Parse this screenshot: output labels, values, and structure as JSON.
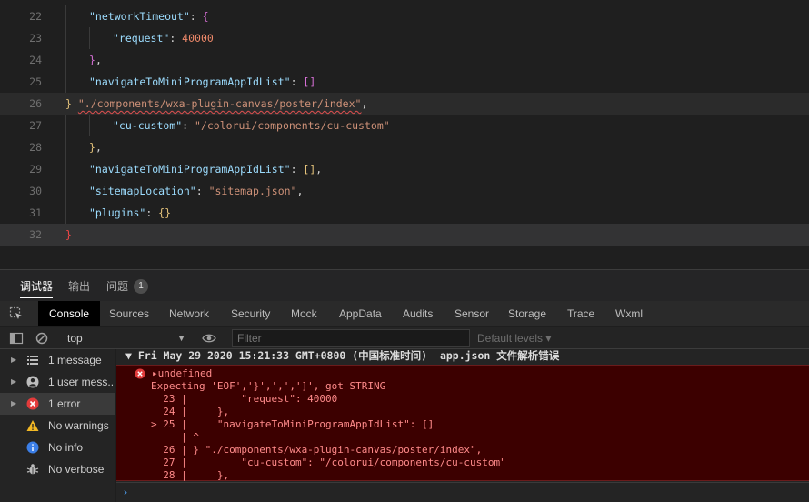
{
  "editor": {
    "lines": [
      {
        "num": "22",
        "indent": 1,
        "parts": [
          {
            "t": "\"networkTimeout\"",
            "c": "k"
          },
          {
            "t": ": ",
            "c": "p"
          },
          {
            "t": "{",
            "c": "b2"
          }
        ]
      },
      {
        "num": "23",
        "indent": 2,
        "parts": [
          {
            "t": "\"request\"",
            "c": "k"
          },
          {
            "t": ": ",
            "c": "p"
          },
          {
            "t": "40000",
            "c": "n"
          }
        ]
      },
      {
        "num": "24",
        "indent": 1,
        "parts": [
          {
            "t": "}",
            "c": "b2"
          },
          {
            "t": ",",
            "c": "p"
          }
        ]
      },
      {
        "num": "25",
        "indent": 1,
        "parts": [
          {
            "t": "\"navigateToMiniProgramAppIdList\"",
            "c": "k"
          },
          {
            "t": ": ",
            "c": "p"
          },
          {
            "t": "[]",
            "c": "b2"
          }
        ]
      },
      {
        "num": "26",
        "indent": 0,
        "parts": [
          {
            "t": "}",
            "c": "b1"
          },
          {
            "t": " ",
            "c": "p"
          },
          {
            "t": "\"./components/wxa-plugin-canvas/poster/index\"",
            "c": "s squig"
          },
          {
            "t": ",",
            "c": "p"
          }
        ]
      },
      {
        "num": "27",
        "indent": 2,
        "parts": [
          {
            "t": "\"cu-custom\"",
            "c": "k"
          },
          {
            "t": ": ",
            "c": "p"
          },
          {
            "t": "\"/colorui/components/cu-custom\"",
            "c": "s"
          }
        ]
      },
      {
        "num": "28",
        "indent": 1,
        "parts": [
          {
            "t": "}",
            "c": "b1"
          },
          {
            "t": ",",
            "c": "p"
          }
        ]
      },
      {
        "num": "29",
        "indent": 1,
        "parts": [
          {
            "t": "\"navigateToMiniProgramAppIdList\"",
            "c": "k"
          },
          {
            "t": ": ",
            "c": "p"
          },
          {
            "t": "[]",
            "c": "b1"
          },
          {
            "t": ",",
            "c": "p"
          }
        ]
      },
      {
        "num": "30",
        "indent": 1,
        "parts": [
          {
            "t": "\"sitemapLocation\"",
            "c": "k"
          },
          {
            "t": ": ",
            "c": "p"
          },
          {
            "t": "\"sitemap.json\"",
            "c": "s"
          },
          {
            "t": ",",
            "c": "p"
          }
        ]
      },
      {
        "num": "31",
        "indent": 1,
        "parts": [
          {
            "t": "\"plugins\"",
            "c": "k"
          },
          {
            "t": ": ",
            "c": "p"
          },
          {
            "t": "{}",
            "c": "b1"
          }
        ]
      },
      {
        "num": "32",
        "indent": 0,
        "parts": [
          {
            "t": "}",
            "c": "err-br"
          }
        ]
      }
    ]
  },
  "panel": {
    "tabs": [
      {
        "label": "调试器",
        "active": true
      },
      {
        "label": "输出",
        "active": false
      },
      {
        "label": "问题",
        "active": false
      }
    ],
    "problems_count": "1"
  },
  "devtools": {
    "tabs": [
      "Console",
      "Sources",
      "Network",
      "Security",
      "Mock",
      "AppData",
      "Audits",
      "Sensor",
      "Storage",
      "Trace",
      "Wxml"
    ],
    "active_tab": "Console"
  },
  "toolbar": {
    "context": "top",
    "filter_placeholder": "Filter",
    "levels_label": "Default levels ▾"
  },
  "sidebar": {
    "items": [
      {
        "label": "1 message",
        "icon": "list-icon",
        "selected": false,
        "expandable": true
      },
      {
        "label": "1 user mess...",
        "icon": "user-icon",
        "selected": false,
        "expandable": true
      },
      {
        "label": "1 error",
        "icon": "error-icon",
        "selected": true,
        "expandable": true
      },
      {
        "label": "No warnings",
        "icon": "warning-icon",
        "selected": false,
        "expandable": false
      },
      {
        "label": "No info",
        "icon": "info-icon",
        "selected": false,
        "expandable": false
      },
      {
        "label": "No verbose",
        "icon": "bug-icon",
        "selected": false,
        "expandable": false
      }
    ]
  },
  "console": {
    "group_header": "▼ Fri May 29 2020 15:21:33 GMT+0800 (中国标准时间)  app.json 文件解析错误",
    "error_lines": [
      "▸undefined",
      "Expecting 'EOF','}',',',']', got STRING",
      "  23 |         \"request\": 40000",
      "  24 |     },",
      "> 25 |     \"navigateToMiniProgramAppIdList\": []",
      "     | ^",
      "  26 | } \"./components/wxa-plugin-canvas/poster/index\",",
      "  27 |         \"cu-custom\": \"/colorui/components/cu-custom\"",
      "  28 |     },"
    ]
  },
  "colors": {
    "error_bg": "#3c0000",
    "error_text": "#ff8a8a",
    "accent_blue": "#4d9ef0"
  }
}
